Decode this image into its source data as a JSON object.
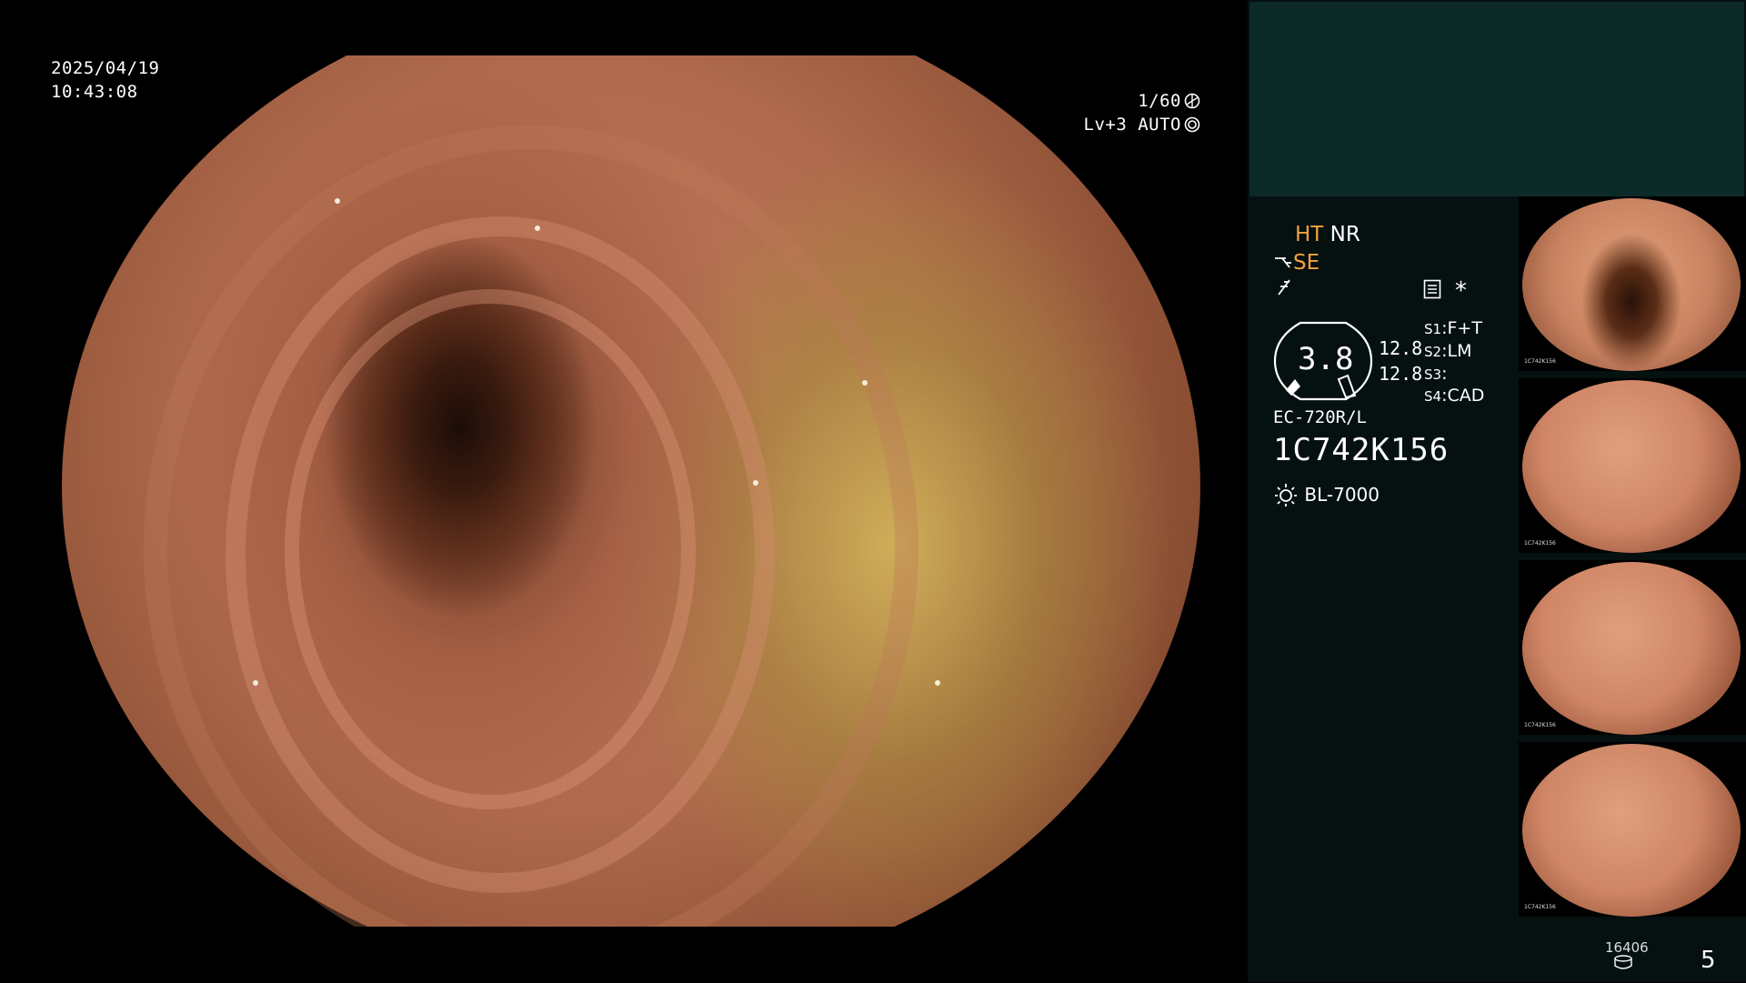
{
  "live_view": {
    "date": "2025/04/19",
    "time": "10:43:08",
    "shutter": "1/60",
    "level_mode": "Lv+3 AUTO"
  },
  "panel": {
    "modes": {
      "ht": "HT",
      "nr": "NR",
      "se": "SE",
      "symbol_icon": "f-slash-icon",
      "scope_icon": "probe-icon",
      "memo_icon": "settings-sheet-icon",
      "star": "*"
    },
    "gauge": {
      "value": "3.8",
      "side_values": [
        "12.8",
        "12.8"
      ]
    },
    "settings": [
      {
        "key": "S1",
        "value": "F+T"
      },
      {
        "key": "S2",
        "value": "LM"
      },
      {
        "key": "S3",
        "value": ""
      },
      {
        "key": "S4",
        "value": "CAD"
      }
    ],
    "scope_model": "EC-720R/L",
    "scope_serial": "1C742K156",
    "light_source": "BL-7000",
    "light_icon": "sun-icon"
  },
  "thumbnails": [
    {
      "label": "1C742K156"
    },
    {
      "label": "1C742K156"
    },
    {
      "label": "1C742K156"
    },
    {
      "label": "1C742K156"
    }
  ],
  "footer": {
    "capture_count": "16406",
    "page_number": "5",
    "storage_icon": "database-icon"
  },
  "colors": {
    "accent_orange": "#f2a23c",
    "panel_bg": "#051010",
    "panel_top_bg": "#0c2a28"
  }
}
